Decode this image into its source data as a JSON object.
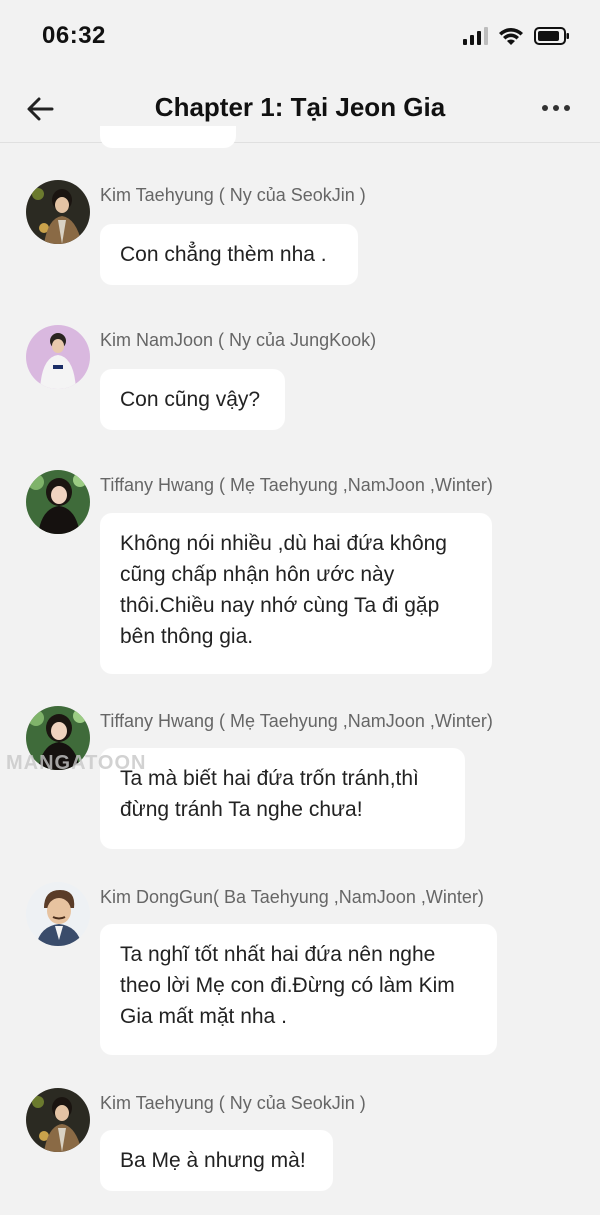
{
  "status_bar": {
    "time": "06:32"
  },
  "nav": {
    "title": "Chapter 1: Tại Jeon Gia"
  },
  "watermark": "MANGATOON",
  "messages": [
    {
      "sender": "Kim Taehyung ( Ny của SeokJin )",
      "text": "Con chẳng thèm nha .",
      "avatar": "taehyung-avatar"
    },
    {
      "sender": "Kim NamJoon ( Ny của JungKook)",
      "text": "Con cũng vậy?",
      "avatar": "namjoon-avatar"
    },
    {
      "sender": "Tiffany Hwang ( Mẹ Taehyung ,NamJoon ,Winter)",
      "text": "Không nói nhiều ,dù hai đứa không cũng chấp nhận hôn ước này thôi.Chiều nay nhớ cùng Ta đi gặp bên thông gia.",
      "avatar": "tiffany-avatar"
    },
    {
      "sender": "Tiffany Hwang ( Mẹ Taehyung ,NamJoon ,Winter)",
      "text": "Ta mà biết hai đứa trốn tránh,thì đừng tránh Ta nghe chưa!",
      "avatar": "tiffany-avatar"
    },
    {
      "sender": "Kim DongGun( Ba Taehyung ,NamJoon ,Winter)",
      "text": "Ta nghĩ tốt nhất hai đứa nên nghe theo lời Mẹ con đi.Đừng có làm Kim Gia mất mặt nha .",
      "avatar": "donggun-avatar"
    },
    {
      "sender": "Kim Taehyung ( Ny của SeokJin )",
      "text": "Ba Mẹ à nhưng mà!",
      "avatar": "taehyung-avatar"
    }
  ]
}
